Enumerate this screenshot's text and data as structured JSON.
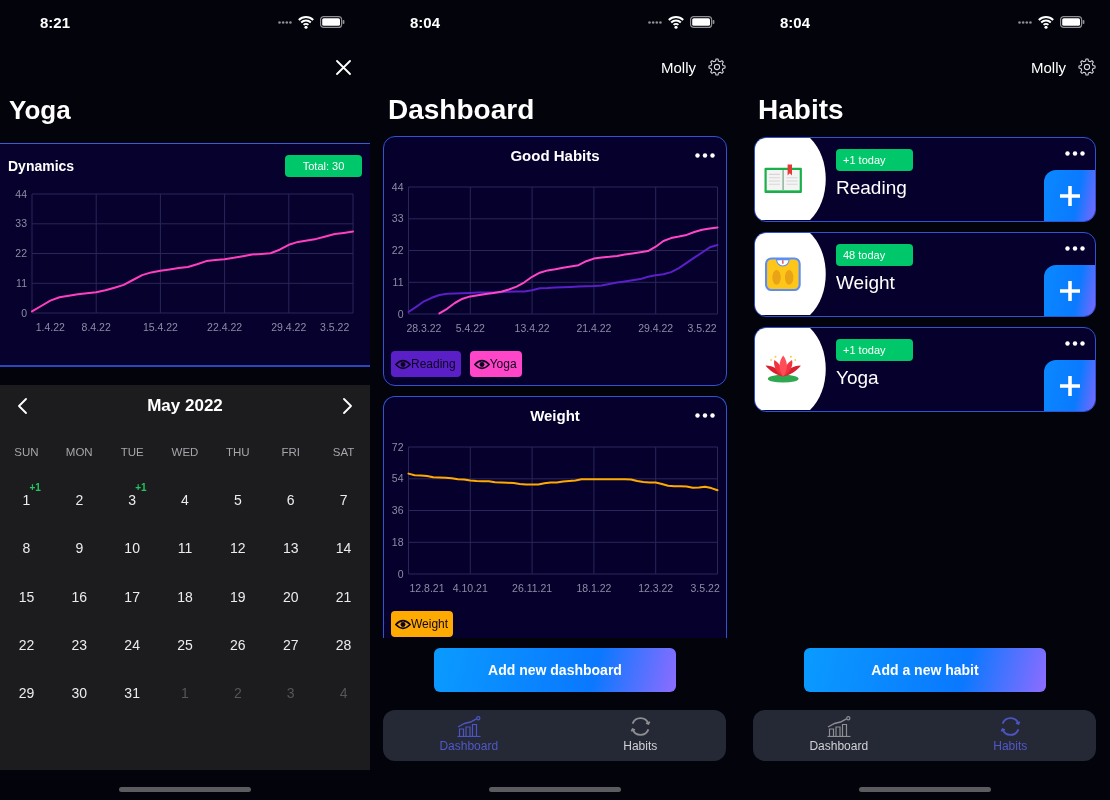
{
  "detail_screen": {
    "status_bar": {
      "time": "8:21"
    },
    "title": "Yoga",
    "dynamics": {
      "title": "Dynamics",
      "total": "Total: 30",
      "chart_data": {
        "type": "line",
        "grid": true,
        "categories": [
          null,
          null,
          "1.4.22",
          null,
          null,
          null,
          null,
          "8.4.22",
          null,
          null,
          null,
          null,
          null,
          null,
          "15.4.22",
          null,
          null,
          null,
          null,
          null,
          null,
          "22.4.22",
          null,
          null,
          null,
          null,
          null,
          null,
          "29.4.22",
          null,
          null,
          null,
          null,
          "3.5.22",
          null,
          null
        ],
        "values": [
          0.6,
          2.6,
          4.6,
          5.8,
          6.4,
          6.9,
          7.3,
          7.7,
          8.4,
          9.3,
          10.4,
          12.2,
          14.0,
          15.0,
          15.6,
          16.1,
          16.6,
          17.0,
          18.0,
          19.2,
          19.6,
          19.9,
          20.4,
          21.0,
          21.6,
          21.8,
          22.1,
          23.4,
          25.2,
          26.3,
          26.8,
          27.4,
          28.3,
          29.2,
          29.6,
          30.1
        ],
        "ylim": [
          0,
          44
        ],
        "yticks": [
          0,
          11,
          22,
          33,
          44
        ]
      }
    },
    "calendar": {
      "month": "May 2022",
      "weekdays": [
        "SUN",
        "MON",
        "TUE",
        "WED",
        "THU",
        "FRI",
        "SAT"
      ],
      "days": [
        {
          "label": "1",
          "in_month": true,
          "mark": "+1"
        },
        {
          "label": "2",
          "in_month": true
        },
        {
          "label": "3",
          "in_month": true,
          "mark": "+1"
        },
        {
          "label": "4",
          "in_month": true
        },
        {
          "label": "5",
          "in_month": true
        },
        {
          "label": "6",
          "in_month": true
        },
        {
          "label": "7",
          "in_month": true
        },
        {
          "label": "8",
          "in_month": true
        },
        {
          "label": "9",
          "in_month": true
        },
        {
          "label": "10",
          "in_month": true
        },
        {
          "label": "11",
          "in_month": true
        },
        {
          "label": "12",
          "in_month": true
        },
        {
          "label": "13",
          "in_month": true
        },
        {
          "label": "14",
          "in_month": true
        },
        {
          "label": "15",
          "in_month": true
        },
        {
          "label": "16",
          "in_month": true
        },
        {
          "label": "17",
          "in_month": true
        },
        {
          "label": "18",
          "in_month": true
        },
        {
          "label": "19",
          "in_month": true
        },
        {
          "label": "20",
          "in_month": true
        },
        {
          "label": "21",
          "in_month": true
        },
        {
          "label": "22",
          "in_month": true
        },
        {
          "label": "23",
          "in_month": true
        },
        {
          "label": "24",
          "in_month": true
        },
        {
          "label": "25",
          "in_month": true
        },
        {
          "label": "26",
          "in_month": true
        },
        {
          "label": "27",
          "in_month": true
        },
        {
          "label": "28",
          "in_month": true
        },
        {
          "label": "29",
          "in_month": true
        },
        {
          "label": "30",
          "in_month": true
        },
        {
          "label": "31",
          "in_month": true
        },
        {
          "label": "1",
          "in_month": false
        },
        {
          "label": "2",
          "in_month": false
        },
        {
          "label": "3",
          "in_month": false
        },
        {
          "label": "4",
          "in_month": false
        }
      ]
    }
  },
  "dashboard_screen": {
    "status_bar": {
      "time": "8:04"
    },
    "user": "Molly",
    "title": "Dashboard",
    "cards": [
      {
        "title": "Good Habits",
        "chart_data": {
          "type": "line",
          "grid": true,
          "categories": [
            null,
            null,
            "28.3.22",
            null,
            null,
            null,
            null,
            null,
            "5.4.22",
            null,
            null,
            null,
            null,
            null,
            null,
            null,
            "13.4.22",
            null,
            null,
            null,
            null,
            null,
            null,
            null,
            "21.4.22",
            null,
            null,
            null,
            null,
            null,
            null,
            null,
            "29.4.22",
            null,
            null,
            null,
            null,
            null,
            "3.5.22",
            null,
            null
          ],
          "series": [
            {
              "name": "Reading",
              "color": "#5b1fc8",
              "values": [
                0.7,
                2.5,
                4.4,
                5.6,
                6.6,
                7.0,
                7.1,
                7.2,
                7.3,
                7.4,
                7.4,
                7.5,
                7.6,
                7.7,
                7.8,
                7.8,
                8.2,
                8.9,
                9.0,
                9.2,
                9.3,
                9.4,
                9.5,
                9.6,
                9.7,
                9.9,
                10.4,
                10.9,
                11.3,
                11.7,
                12.1,
                12.9,
                13.4,
                13.8,
                14.5,
                15.9,
                17.7,
                19.5,
                21.3,
                23.1,
                23.9
              ]
            },
            {
              "name": "Yoga",
              "color": "#ff45c8",
              "values": [
                null,
                null,
                null,
                null,
                0.2,
                1.8,
                3.8,
                5.3,
                6.1,
                6.5,
                6.9,
                7.3,
                7.7,
                8.5,
                9.5,
                11.0,
                12.9,
                14.3,
                15.1,
                15.5,
                16.0,
                16.5,
                16.9,
                18.3,
                19.2,
                19.6,
                19.8,
                20.1,
                20.6,
                21.0,
                21.4,
                21.8,
                23.3,
                25.3,
                26.3,
                26.8,
                27.4,
                28.4,
                29.2,
                29.6,
                30.0
              ]
            }
          ],
          "ylim": [
            0,
            44
          ],
          "yticks": [
            0,
            11,
            22,
            33,
            44
          ]
        }
      },
      {
        "title": "Weight",
        "chart_data": {
          "type": "line",
          "grid": true,
          "categories": [
            null,
            null,
            null,
            "12.8.21",
            null,
            null,
            null,
            null,
            null,
            null,
            "4.10.21",
            null,
            null,
            null,
            null,
            null,
            null,
            null,
            null,
            null,
            "26.11.21",
            null,
            null,
            null,
            null,
            null,
            null,
            null,
            null,
            null,
            "18.1.22",
            null,
            null,
            null,
            null,
            null,
            null,
            null,
            null,
            null,
            "12.3.22",
            null,
            null,
            null,
            null,
            null,
            null,
            null,
            "3.5.22",
            null,
            null
          ],
          "series": [
            {
              "name": "Weight",
              "color": "#ffaa00",
              "values": [
                56.9,
                56.0,
                55.8,
                55.6,
                54.8,
                54.7,
                54.6,
                54.3,
                53.7,
                53.5,
                53.0,
                52.7,
                52.6,
                52.6,
                52.0,
                51.8,
                51.7,
                51.6,
                51.1,
                50.7,
                50.7,
                50.7,
                51.4,
                51.8,
                51.8,
                52.5,
                52.7,
                53.0,
                53.7,
                53.7,
                53.7,
                53.7,
                53.7,
                53.7,
                53.7,
                53.7,
                53.6,
                52.7,
                52.1,
                51.8,
                51.8,
                51.0,
                50.0,
                49.7,
                49.7,
                49.6,
                48.9,
                49.1,
                49.5,
                48.7,
                47.5
              ]
            }
          ],
          "ylim": [
            0,
            72
          ],
          "yticks": [
            0,
            18,
            36,
            54,
            72
          ]
        }
      }
    ],
    "add_button": "Add new dashboard",
    "tabs": [
      {
        "label": "Dashboard",
        "selected": true
      },
      {
        "label": "Habits",
        "selected": false
      }
    ]
  },
  "habits_screen": {
    "status_bar": {
      "time": "8:04"
    },
    "user": "Molly",
    "title": "Habits",
    "habits": [
      {
        "name": "Reading",
        "count": "+1 today"
      },
      {
        "name": "Weight",
        "count": "48 today"
      },
      {
        "name": "Yoga",
        "count": "+1 today"
      }
    ],
    "add_button": "Add a new habit",
    "tabs": [
      {
        "label": "Dashboard",
        "selected": false
      },
      {
        "label": "Habits",
        "selected": true
      }
    ]
  }
}
